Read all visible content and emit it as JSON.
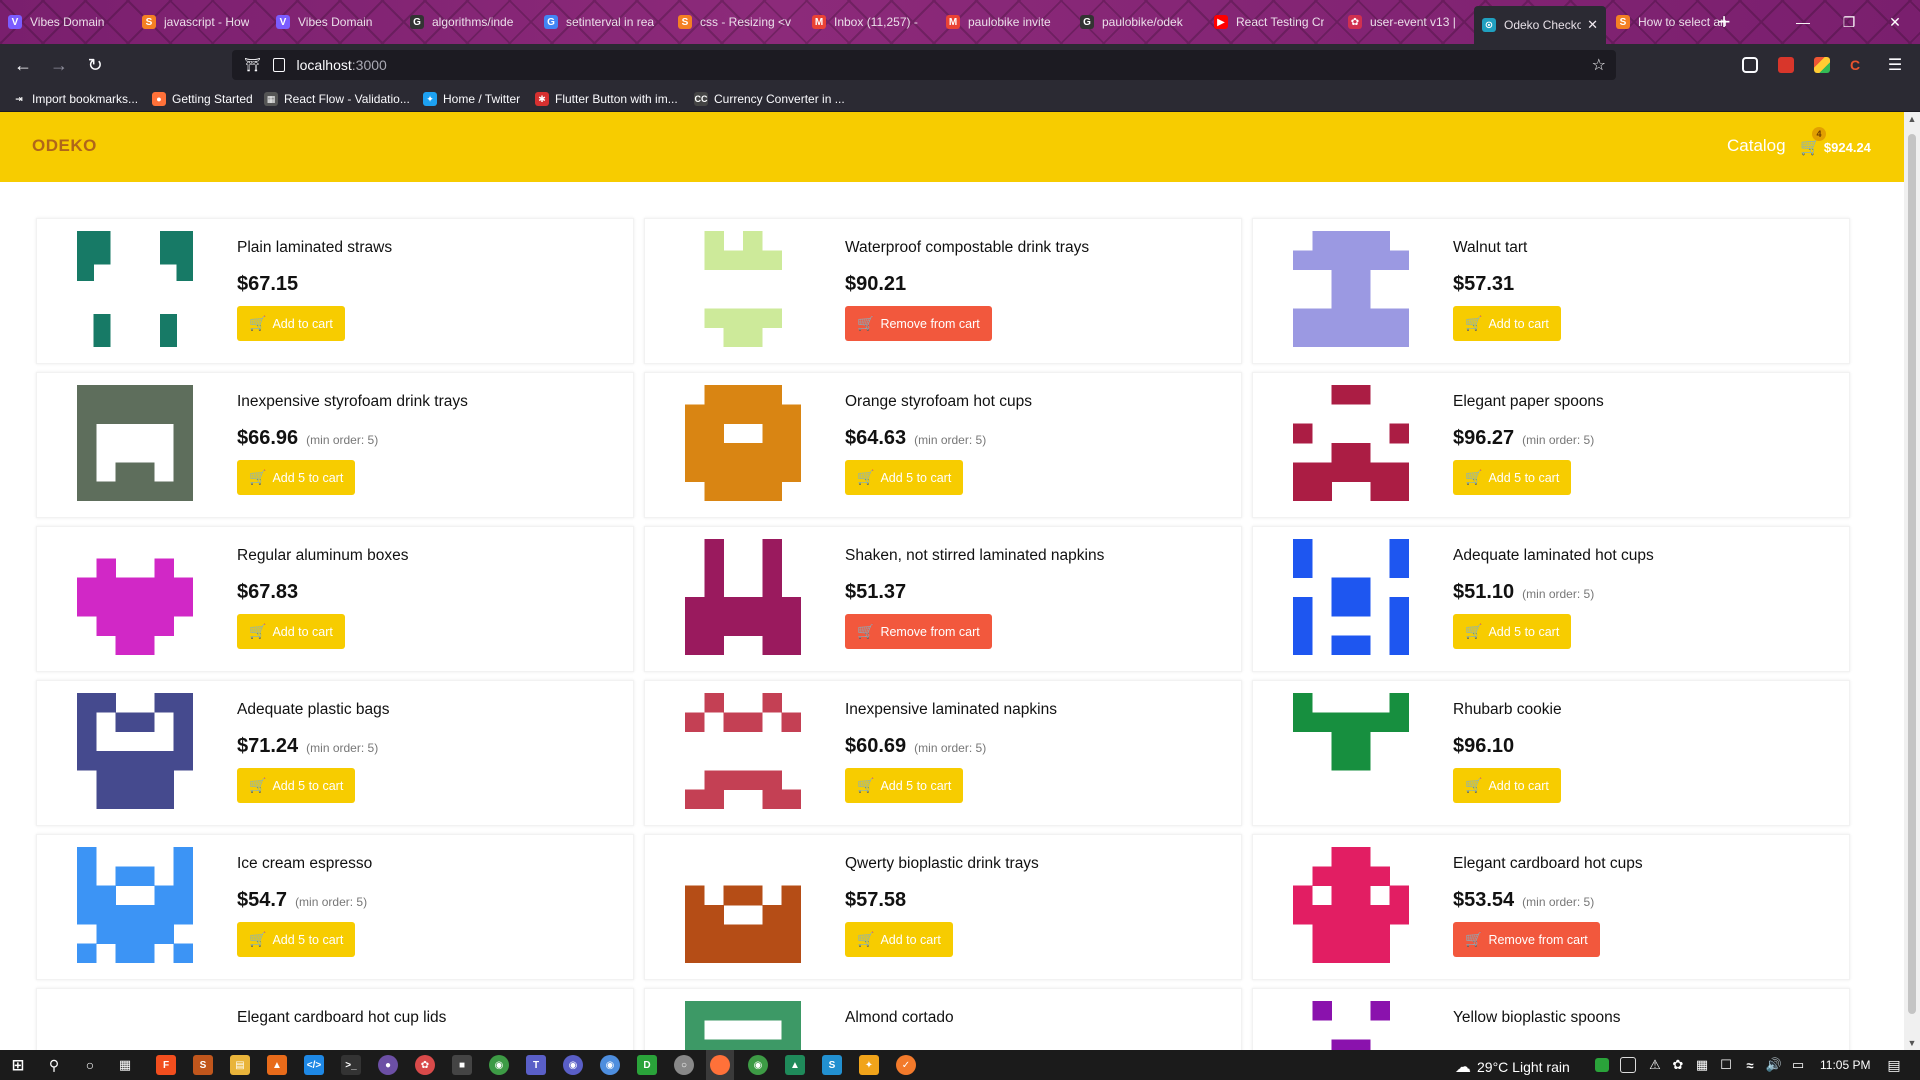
{
  "browser": {
    "tabs": [
      {
        "title": "Vibes Domain",
        "icon": "V",
        "color": "#7b5cff"
      },
      {
        "title": "javascript - How",
        "icon": "S",
        "color": "#f48024"
      },
      {
        "title": "Vibes Domain",
        "icon": "V",
        "color": "#7b5cff"
      },
      {
        "title": "algorithms/inde",
        "icon": "G",
        "color": "#333333"
      },
      {
        "title": "setinterval in rea",
        "icon": "G",
        "color": "#4285f4"
      },
      {
        "title": "css - Resizing <v",
        "icon": "S",
        "color": "#f48024"
      },
      {
        "title": "Inbox (11,257) -",
        "icon": "M",
        "color": "#ea4335"
      },
      {
        "title": "paulobike invite",
        "icon": "M",
        "color": "#ea4335"
      },
      {
        "title": "paulobike/odek",
        "icon": "G",
        "color": "#333333"
      },
      {
        "title": "React Testing Cr",
        "icon": "▶",
        "color": "#ff0000"
      },
      {
        "title": "user-event v13 |",
        "icon": "✿",
        "color": "#d03050"
      },
      {
        "title": "Odeko Checko",
        "icon": "⊙",
        "color": "#20a0c0",
        "active": true
      },
      {
        "title": "How to select an",
        "icon": "S",
        "color": "#f48024"
      }
    ],
    "url": "localhost",
    "url_port": ":3000",
    "bookmarks": [
      {
        "label": "Import bookmarks...",
        "icon": "⇥",
        "color": "#2b2a33"
      },
      {
        "label": "Getting Started",
        "icon": "●",
        "color": "#ff7139"
      },
      {
        "label": "React Flow - Validatio...",
        "icon": "▦",
        "color": "#555555"
      },
      {
        "label": "Home / Twitter",
        "icon": "✦",
        "color": "#1da1f2"
      },
      {
        "label": "Flutter Button with im...",
        "icon": "✱",
        "color": "#d63030"
      },
      {
        "label": "Currency Converter in ...",
        "icon": "CC",
        "color": "#444444"
      }
    ]
  },
  "app": {
    "brand": "ODEKO",
    "catalog_link": "Catalog",
    "cart_count": "4",
    "cart_total": "$924.24",
    "labels": {
      "add": "Add to cart",
      "add5": "Add 5 to cart",
      "remove": "Remove from cart",
      "min_order": "(min order: 5)"
    }
  },
  "products": [
    {
      "name": "Plain laminated straws",
      "price": "$67.15",
      "min_order": false,
      "button": "add",
      "color": "#177a66",
      "pattern": [
        "1100011",
        "1100011",
        "1000001",
        "0000000",
        "0000000",
        "0100010",
        "0100010"
      ]
    },
    {
      "name": "Waterproof compostable drink trays",
      "price": "$90.21",
      "min_order": false,
      "button": "remove",
      "color": "#cdea9a",
      "pattern": [
        "010100",
        "011110",
        "000000",
        "000000",
        "011110",
        "001100"
      ]
    },
    {
      "name": "Walnut tart",
      "price": "$57.31",
      "min_order": false,
      "button": "add",
      "color": "#9b99e2",
      "pattern": [
        "011110",
        "111111",
        "001100",
        "001100",
        "111111",
        "111111"
      ]
    },
    {
      "name": "Inexpensive styrofoam drink trays",
      "price": "$66.96",
      "min_order": true,
      "button": "add5",
      "color": "#5e6e5c",
      "pattern": [
        "111111",
        "111111",
        "100001",
        "100001",
        "101101",
        "111111"
      ]
    },
    {
      "name": "Orange styrofoam hot cups",
      "price": "$64.63",
      "min_order": true,
      "button": "add5",
      "color": "#d98513",
      "pattern": [
        "011110",
        "111111",
        "110011",
        "111111",
        "111111",
        "011110"
      ]
    },
    {
      "name": "Elegant paper spoons",
      "price": "$96.27",
      "min_order": true,
      "button": "add5",
      "color": "#ab1d44",
      "pattern": [
        "001100",
        "000000",
        "100001",
        "001100",
        "111111",
        "110011"
      ]
    },
    {
      "name": "Regular aluminum boxes",
      "price": "$67.83",
      "min_order": false,
      "button": "add",
      "color": "#d128c6",
      "pattern": [
        "000000",
        "010010",
        "111111",
        "111111",
        "011110",
        "001100"
      ]
    },
    {
      "name": "Shaken, not stirred laminated napkins",
      "price": "$51.37",
      "min_order": false,
      "button": "remove",
      "color": "#9a1a5e",
      "pattern": [
        "010010",
        "010010",
        "010010",
        "111111",
        "111111",
        "110011"
      ]
    },
    {
      "name": "Adequate laminated hot cups",
      "price": "$51.10",
      "min_order": true,
      "button": "add5",
      "color": "#1e56f0",
      "pattern": [
        "100001",
        "100001",
        "001100",
        "101101",
        "100001",
        "101101"
      ]
    },
    {
      "name": "Adequate plastic bags",
      "price": "$71.24",
      "min_order": true,
      "button": "add5",
      "color": "#454a8e",
      "pattern": [
        "110011",
        "101101",
        "100001",
        "111111",
        "011110",
        "011110"
      ]
    },
    {
      "name": "Inexpensive laminated napkins",
      "price": "$60.69",
      "min_order": true,
      "button": "add5",
      "color": "#c44054",
      "pattern": [
        "010010",
        "101101",
        "000000",
        "000000",
        "011110",
        "110011"
      ]
    },
    {
      "name": "Rhubarb cookie",
      "price": "$96.10",
      "min_order": false,
      "button": "add",
      "color": "#178f3f",
      "pattern": [
        "100001",
        "111111",
        "001100",
        "001100",
        "000000",
        "000000"
      ]
    },
    {
      "name": "Ice cream espresso",
      "price": "$54.7",
      "min_order": true,
      "button": "add5",
      "color": "#3c94f5",
      "pattern": [
        "100001",
        "101101",
        "110011",
        "111111",
        "011110",
        "101101"
      ]
    },
    {
      "name": "Qwerty bioplastic drink trays",
      "price": "$57.58",
      "min_order": false,
      "button": "add",
      "color": "#b54d16",
      "pattern": [
        "000000",
        "000000",
        "101101",
        "110011",
        "111111",
        "111111"
      ]
    },
    {
      "name": "Elegant cardboard hot cups",
      "price": "$53.54",
      "min_order": true,
      "button": "remove",
      "color": "#e21e63",
      "pattern": [
        "001100",
        "011110",
        "101101",
        "111111",
        "011110",
        "011110"
      ]
    },
    {
      "name": "Elegant cardboard hot cup lids",
      "price": "",
      "min_order": false,
      "button": "add",
      "color": "#e6c200",
      "pattern": [
        "000000",
        "000000",
        "000000",
        "000000",
        "000000",
        "011110"
      ]
    },
    {
      "name": "Almond cortado",
      "price": "",
      "min_order": false,
      "button": "add",
      "color": "#3d9966",
      "pattern": [
        "111111",
        "100001",
        "111111",
        "111111",
        "111111",
        "111111"
      ]
    },
    {
      "name": "Yellow bioplastic spoons",
      "price": "",
      "min_order": false,
      "button": "add",
      "color": "#8a12ad",
      "pattern": [
        "010010",
        "000000",
        "001100",
        "000000",
        "000000",
        "000000"
      ]
    }
  ],
  "taskbar": {
    "temperature": "29°C",
    "weather": "Light rain",
    "time": "11:05 PM"
  }
}
